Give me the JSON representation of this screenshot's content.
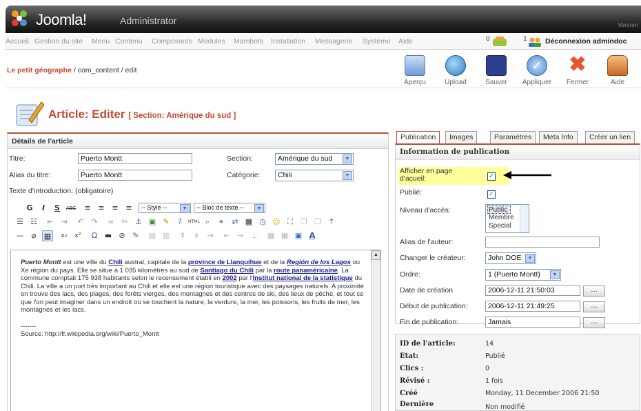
{
  "header": {
    "brand": "Joomla!",
    "admin": "Administrator",
    "version": "Version"
  },
  "menu": {
    "items": [
      "Accueil",
      "Gestion du site",
      "Menu",
      "Contenu",
      "Composants",
      "Modules",
      "Mambots",
      "Installation",
      "Messagerie",
      "Système",
      "Aide"
    ],
    "messages_count": "0",
    "users_count": "1",
    "logout": "Déconnexion admindoc"
  },
  "breadcrumb": {
    "site": "Le petit géographe",
    "path": " / com_content / edit"
  },
  "toolbar": {
    "preview": "Aperçu",
    "upload": "Upload",
    "save": "Sauver",
    "apply": "Appliquer",
    "close": "Fermer",
    "help": "Aide"
  },
  "page": {
    "title": "Article: Editer",
    "section_tag": "[ Section: Amérique du sud ]"
  },
  "details": {
    "heading": "Détails de l'article",
    "title_label": "Titre:",
    "title_value": "Puerto Montt",
    "alias_label": "Alias du titre:",
    "alias_value": "Puerto Montt",
    "section_label": "Section:",
    "section_value": "Amérique du sud",
    "category_label": "Catégorie:",
    "category_value": "Chili",
    "intro_label": "Texte d'introduction: (obligatoire)",
    "style_select": "-- Style --",
    "block_select": "-- Bloc de texte --"
  },
  "editor": {
    "p1_start_bold_italic": "Puerto Montt",
    "p1_a": " est une ville du ",
    "link_chili": "Chili",
    "p1_b": " austral, capitale de la ",
    "link_llanquihue": "province de Llanquihue",
    "p1_c": " et de la ",
    "link_region": "Región de los Lagos",
    "p1_d": " ou Xe région du pays. Elle se situe à 1 035 kilomètres au sud de ",
    "link_santiago": "Santiago du Chili",
    "p1_e": " par la ",
    "link_route": "route panaméricaine",
    "p1_f": ". La commune comptait 175 938 habitants selon le recensement établi en ",
    "link_2002": "2002",
    "p1_g": " par l'",
    "link_institut": "Institut national de la statistique",
    "p1_h": " du Chili. La ville a un port très important au Chili et elle est une région touristique avec des paysages naturels. A proximité on trouve des lacs, des plages, des forêts vierges, des montagnes et des centres de ski, des lieux de pêche, et tout ce que l'on peut imaginer dans un endroit où se touchent la nature, la verdure, la mer, les poissons, les fruits de mer, les montagnes et les lacs.",
    "sep": "-------",
    "source": "Source: http://fr.wikipedia.org/wiki/Puerto_Montt"
  },
  "tabs": [
    "Publication",
    "Images",
    "Paramètres",
    "Meta Info",
    "Créer un lien"
  ],
  "publication": {
    "heading": "Information de publication",
    "frontpage_label": "Afficher en page d'acueil:",
    "frontpage_checked": true,
    "published_label": "Publié:",
    "published_checked": true,
    "access_label": "Niveau d'accès:",
    "access_options": [
      "Public",
      "Membre",
      "Special"
    ],
    "access_selected": "Public",
    "author_alias_label": "Alias de l'auteur:",
    "author_alias_value": "",
    "creator_label": "Changer le créateur:",
    "creator_value": "John DOE",
    "order_label": "Ordre:",
    "order_value": "1 (Puerto Montt)",
    "created_label": "Date de création",
    "created_value": "2006-12-11 21:50:03",
    "start_label": "Début de publication:",
    "start_value": "2006-12-11 21:49:25",
    "end_label": "Fin de publication:",
    "end_value": "Jamais",
    "dots": "...",
    "highlight_color": "#fffe9a"
  },
  "info": {
    "id_label": "ID de l'article:",
    "id_value": "14",
    "state_label": "Etat:",
    "state_value": "Publié",
    "clicks_label": "Clics :",
    "clicks_value": "0",
    "revised_label": "Révisé :",
    "revised_value": "1 fois",
    "created_label": "Créé",
    "created_value": "Monday, 11 December 2006 21:50",
    "last_label": "Dernière",
    "last_value": "Non modifié"
  },
  "colors": {
    "accent": "#c64934",
    "link": "#1b1b8f"
  }
}
